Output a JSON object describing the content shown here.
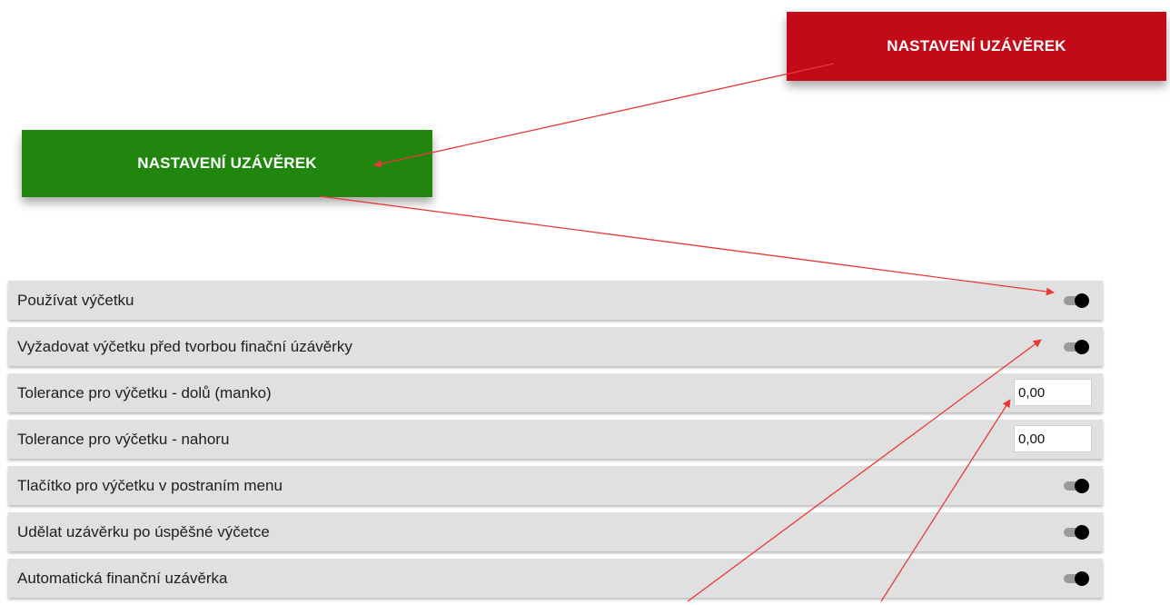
{
  "buttons": {
    "red_label": "NASTAVENÍ UZÁVĚREK",
    "green_label": "NASTAVENÍ UZÁVĚREK",
    "red_color": "#c20a18",
    "green_color": "#21860e"
  },
  "settings": [
    {
      "label": "Používat výčetku",
      "control": "toggle",
      "on": true
    },
    {
      "label": "Vyžadovat výčetku před tvorbou finační úzávěrky",
      "control": "toggle",
      "on": true
    },
    {
      "label": "Tolerance pro výčetku - dolů (manko)",
      "control": "input",
      "value": "0,00"
    },
    {
      "label": "Tolerance pro výčetku - nahoru",
      "control": "input",
      "value": "0,00"
    },
    {
      "label": "Tlačítko pro výčetku v postraním menu",
      "control": "toggle",
      "on": true
    },
    {
      "label": "Udělat uzávěrku po úspěšné výčetce",
      "control": "toggle",
      "on": true
    },
    {
      "label": "Automatická finanční uzávěrka",
      "control": "toggle",
      "on": true
    }
  ],
  "annotation_color": "#e8393a"
}
